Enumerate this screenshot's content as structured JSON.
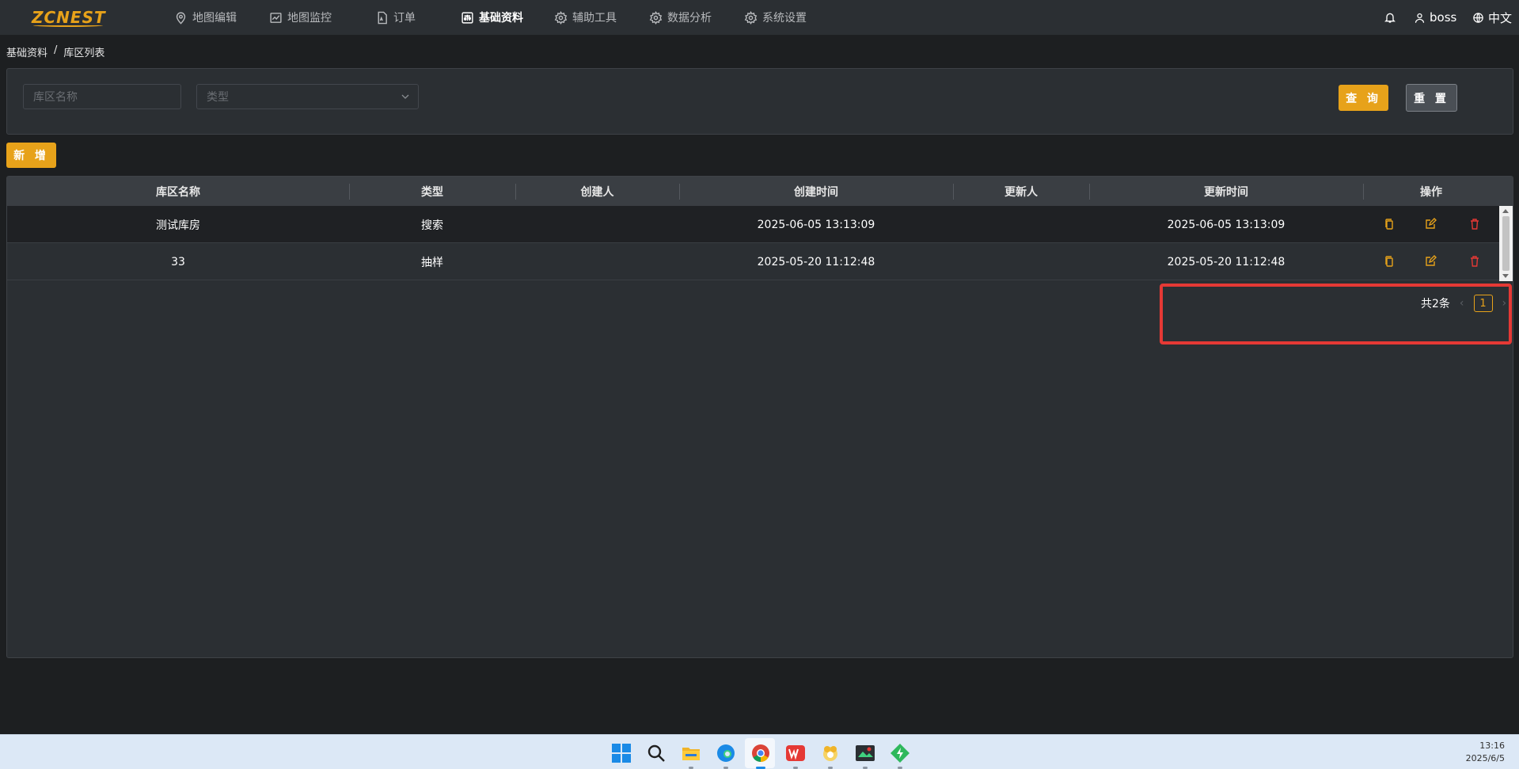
{
  "app": {
    "logo_text": "ZCNEST",
    "brand_color": "#e7a21a"
  },
  "nav": {
    "items": [
      {
        "label": "地图编辑",
        "icon": "map-pin-icon",
        "active": false
      },
      {
        "label": "地图监控",
        "icon": "chart-line-icon",
        "active": false
      },
      {
        "label": "订单",
        "icon": "document-icon",
        "active": false
      },
      {
        "label": "基础资料",
        "icon": "sliders-icon",
        "active": true
      },
      {
        "label": "辅助工具",
        "icon": "gear-icon",
        "active": false
      },
      {
        "label": "数据分析",
        "icon": "gear-icon",
        "active": false
      },
      {
        "label": "系统设置",
        "icon": "gear-icon",
        "active": false
      }
    ],
    "right": {
      "notification_icon": "bell-icon",
      "user_label": "boss",
      "user_icon": "user-icon",
      "language_label": "中文",
      "language_icon": "globe-icon"
    }
  },
  "breadcrumb": {
    "root": "基础资料",
    "separator": "/",
    "current": "库区列表"
  },
  "filters": {
    "name_placeholder": "库区名称",
    "type_placeholder": "类型",
    "query_label": "查 询",
    "reset_label": "重 置"
  },
  "actions": {
    "add_label": "新 增"
  },
  "table": {
    "columns": [
      "库区名称",
      "类型",
      "创建人",
      "创建时间",
      "更新人",
      "更新时间",
      "操作"
    ],
    "rows": [
      {
        "name": "测试库房",
        "type": "搜索",
        "creator": "",
        "created_at": "2025-06-05 13:13:09",
        "updater": "",
        "updated_at": "2025-06-05 13:13:09"
      },
      {
        "name": "33",
        "type": "抽样",
        "creator": "",
        "created_at": "2025-05-20 11:12:48",
        "updater": "",
        "updated_at": "2025-05-20 11:12:48"
      }
    ],
    "row_actions": [
      "copy-icon",
      "edit-icon",
      "delete-icon"
    ]
  },
  "pagination": {
    "total_label": "共2条",
    "current_page": "1",
    "prev_icon": "chevron-left-icon",
    "next_icon": "chevron-right-icon"
  },
  "taskbar": {
    "apps": [
      "windows-start-icon",
      "search-icon",
      "file-explorer-icon",
      "edge-browser-icon",
      "chrome-browser-icon",
      "wps-office-icon",
      "app-icon",
      "screenshot-tool-icon",
      "green-app-icon"
    ],
    "time": "13:16",
    "date": "2025/6/5"
  }
}
